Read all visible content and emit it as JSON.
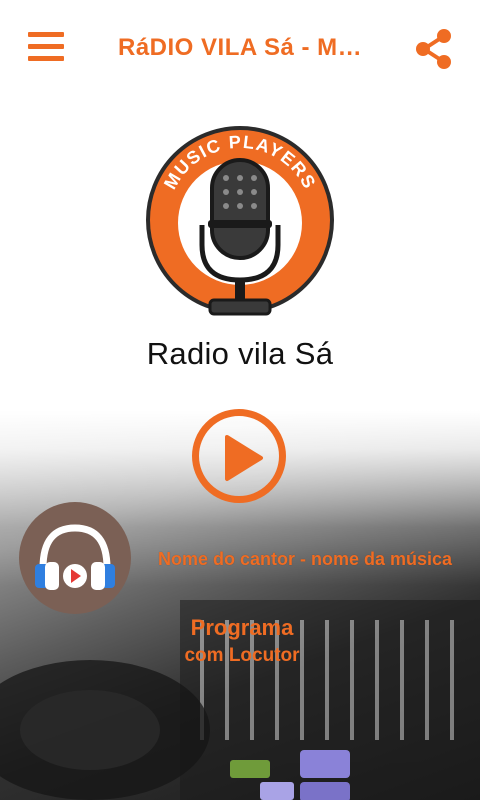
{
  "header": {
    "title": "RáDIO VILA Sá - MUSIC PLAYERS",
    "menu_icon": "hamburger-menu-icon",
    "share_icon": "share-icon"
  },
  "logo": {
    "ring_text": "MUSIC PLAYERS",
    "icon": "microphone-icon"
  },
  "station": {
    "name": "Radio vila Sá"
  },
  "player": {
    "play_icon": "play-icon",
    "now_playing": "Nome do cantor - nome da música",
    "cover_icon": "headphones-icon"
  },
  "program": {
    "title": "Programa",
    "host": "com Locutor"
  },
  "colors": {
    "accent": "#ef6c23",
    "cover_bg": "#7b6055"
  }
}
